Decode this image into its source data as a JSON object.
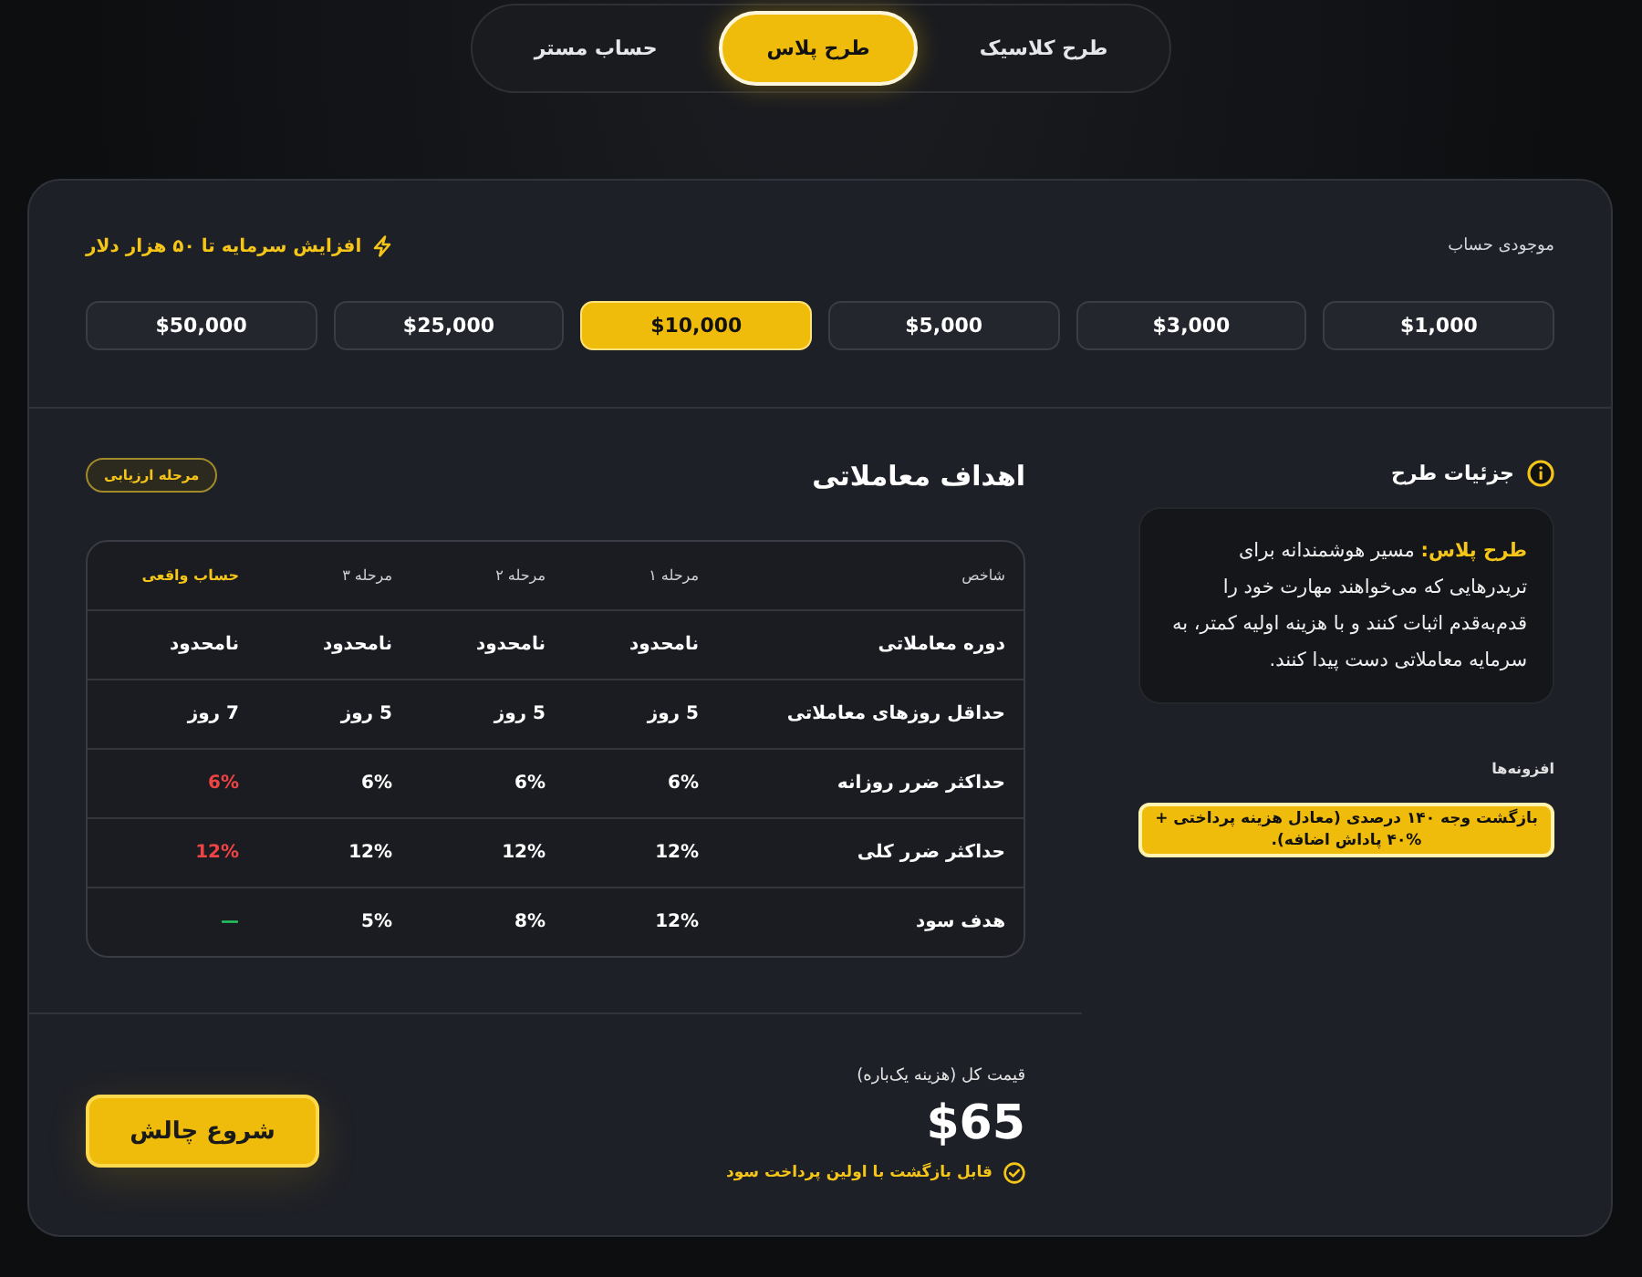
{
  "plan_tabs": [
    {
      "label": "طرح کلاسیک",
      "selected": false
    },
    {
      "label": "طرح پلاس",
      "selected": true
    },
    {
      "label": "حساب مستر",
      "selected": false
    }
  ],
  "balance": {
    "label": "موجودی حساب",
    "note": "افزایش سرمایه تا ۵۰ هزار دلار",
    "options": [
      {
        "label": "$1,000",
        "selected": false
      },
      {
        "label": "$3,000",
        "selected": false
      },
      {
        "label": "$5,000",
        "selected": false
      },
      {
        "label": "$10,000",
        "selected": true
      },
      {
        "label": "$25,000",
        "selected": false
      },
      {
        "label": "$50,000",
        "selected": false
      }
    ]
  },
  "details": {
    "title": "جزئیات طرح",
    "description": "**طرح پلاس:** مسیر هوشمندانه برای تریدرهایی که می‌خواهند مهارت خود را قدم‌به‌قدم اثبات کنند و با هزینه اولیه کمتر، به سرمایه معاملاتی دست پیدا کنند.",
    "addons_label": "افزونه‌ها",
    "addons": [
      "بازگشت وجه ۱۴۰ درصدی (معادل هزینه پرداختی + %۴۰ پاداش اضافه)."
    ]
  },
  "goals": {
    "title": "اهداف معاملاتی",
    "badge": "مرحله ارزیابی",
    "columns": [
      {
        "label": "شاخص",
        "highlighted": false
      },
      {
        "label": "مرحله ۱",
        "highlighted": false
      },
      {
        "label": "مرحله ۲",
        "highlighted": false
      },
      {
        "label": "مرحله ۳",
        "highlighted": false
      },
      {
        "label": "حساب واقعی",
        "highlighted": true
      }
    ],
    "rows": [
      {
        "metric": "دوره معاملاتی",
        "values": [
          {
            "text": "نامحدود"
          },
          {
            "text": "نامحدود"
          },
          {
            "text": "نامحدود"
          },
          {
            "text": "نامحدود"
          }
        ]
      },
      {
        "metric": "حداقل روزهای معاملاتی",
        "values": [
          {
            "text": "5 روز"
          },
          {
            "text": "5 روز"
          },
          {
            "text": "5 روز"
          },
          {
            "text": "7 روز"
          }
        ]
      },
      {
        "metric": "حداکثر ضرر روزانه",
        "values": [
          {
            "text": "6%"
          },
          {
            "text": "6%"
          },
          {
            "text": "6%"
          },
          {
            "text": "6%",
            "color": "#ef4444"
          }
        ]
      },
      {
        "metric": "حداکثر ضرر کلی",
        "values": [
          {
            "text": "12%"
          },
          {
            "text": "12%"
          },
          {
            "text": "12%"
          },
          {
            "text": "12%",
            "color": "#ef4444"
          }
        ]
      },
      {
        "metric": "هدف سود",
        "values": [
          {
            "text": "12%"
          },
          {
            "text": "8%"
          },
          {
            "text": "5%"
          },
          {
            "text": "—",
            "color": "#22c55e"
          }
        ]
      }
    ]
  },
  "price": {
    "label": "قیمت کل (هزینه یک‌باره)",
    "amount": "$65",
    "note": "قابل بازگشت با اولین پرداخت سود",
    "button": "شروع چالش"
  }
}
